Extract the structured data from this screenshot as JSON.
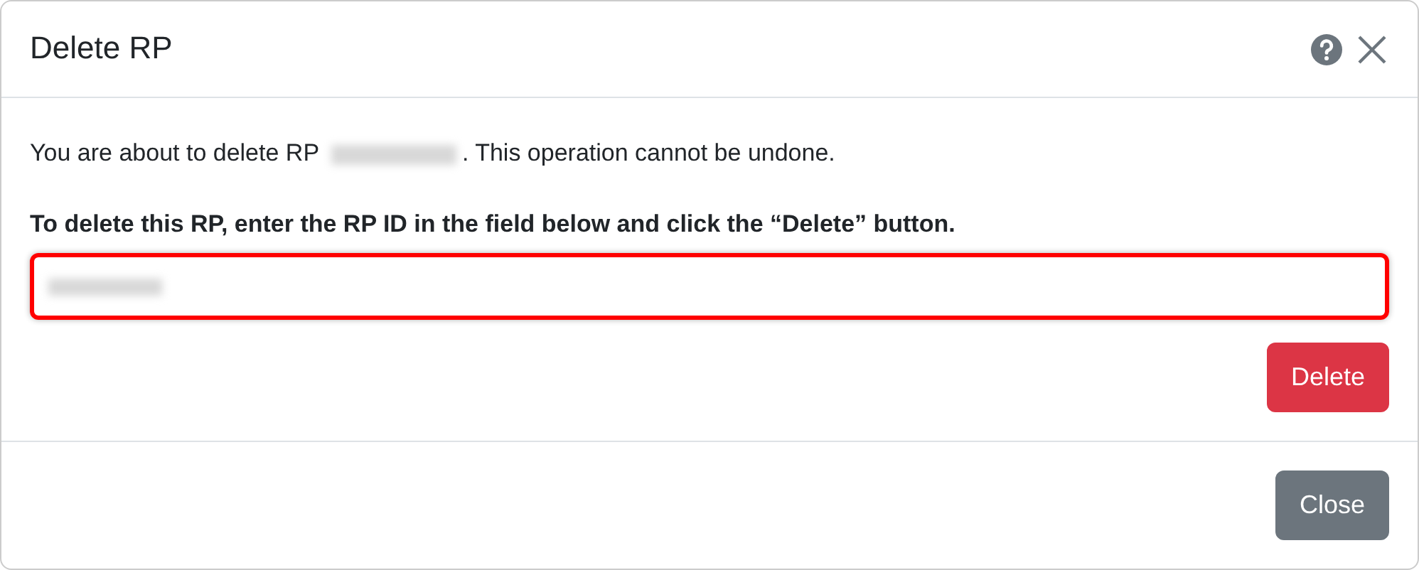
{
  "dialog": {
    "title": "Delete RP",
    "message_before": "You are about to delete RP",
    "message_after": ". This operation cannot be undone.",
    "instruction": "To delete this RP, enter the RP ID in the field below and click the “Delete” button.",
    "field": {
      "highlighted": true
    },
    "delete_button": "Delete",
    "footer_buttons": [
      "Close"
    ]
  }
}
